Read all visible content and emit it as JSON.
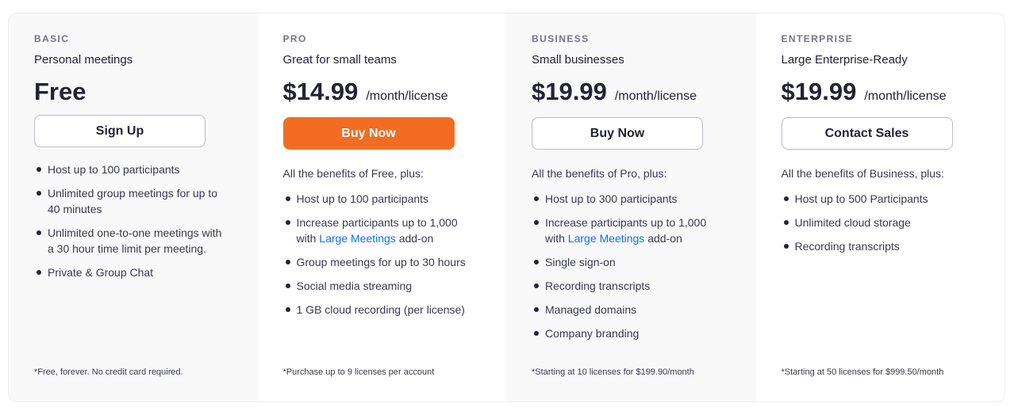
{
  "plans": [
    {
      "tier": "BASIC",
      "subtitle": "Personal meetings",
      "price": "Free",
      "per": "",
      "button": "Sign Up",
      "button_style": "outline",
      "intro": "",
      "features": [
        {
          "text": "Host up to 100 participants"
        },
        {
          "text": "Unlimited group meetings for up to 40 minutes"
        },
        {
          "text": "Unlimited one-to-one meetings with a 30 hour time limit per meeting."
        },
        {
          "text": "Private & Group Chat"
        }
      ],
      "footnote": "*Free, forever. No credit card required."
    },
    {
      "tier": "PRO",
      "subtitle": "Great for small teams",
      "price": "$14.99",
      "per": "/month/license",
      "button": "Buy Now",
      "button_style": "primary",
      "intro": "All the benefits of Free, plus:",
      "features": [
        {
          "text": "Host up to 100 participants"
        },
        {
          "pre": "Increase participants up to 1,000 with ",
          "link": "Large Meetings",
          "post": " add-on"
        },
        {
          "text": "Group meetings for up to 30 hours"
        },
        {
          "text": "Social media streaming"
        },
        {
          "text": "1 GB cloud recording (per license)"
        }
      ],
      "footnote": "*Purchase up to 9 licenses per account"
    },
    {
      "tier": "BUSINESS",
      "subtitle": "Small businesses",
      "price": "$19.99",
      "per": "/month/license",
      "button": "Buy Now",
      "button_style": "outline",
      "intro": "All the benefits of Pro, plus:",
      "features": [
        {
          "text": "Host up to 300 participants"
        },
        {
          "pre": "Increase participants up to 1,000 with ",
          "link": "Large Meetings",
          "post": " add-on"
        },
        {
          "text": "Single sign-on"
        },
        {
          "text": "Recording transcripts"
        },
        {
          "text": "Managed domains"
        },
        {
          "text": "Company branding"
        }
      ],
      "footnote": "*Starting at 10 licenses for $199.90/month"
    },
    {
      "tier": "ENTERPRISE",
      "subtitle": "Large Enterprise-Ready",
      "price": "$19.99",
      "per": "/month/license",
      "button": "Contact Sales",
      "button_style": "outline",
      "intro": "All the benefits of Business, plus:",
      "features": [
        {
          "text": "Host up to 500 Participants"
        },
        {
          "text": "Unlimited cloud storage"
        },
        {
          "text": "Recording transcripts"
        }
      ],
      "footnote": "*Starting at 50 licenses for $999.50/month"
    }
  ],
  "colors": {
    "primary_button": "#f26d21",
    "link": "#0e72ed",
    "tier_label": "#747487",
    "text": "#232333"
  }
}
